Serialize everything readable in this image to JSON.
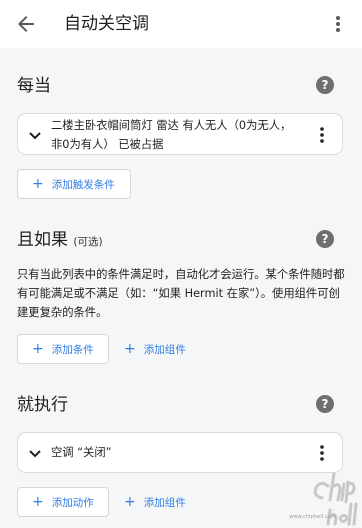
{
  "header": {
    "title": "自动关空调"
  },
  "trigger_section": {
    "title": "每当",
    "trigger_text": "二楼主卧衣帽间筒灯 雷达 有人无人（0为无人，非0为有人） 已被占据",
    "add_button": "添加触发条件"
  },
  "condition_section": {
    "title": "且如果",
    "optional_label": "(可选)",
    "description": "只有当此列表中的条件满足时，自动化才会运行。某个条件随时都有可能满足或不满足（如：“如果 Hermit 在家”）。使用组件可创建更复杂的条件。",
    "add_condition_button": "添加条件",
    "add_block_button": "添加组件"
  },
  "action_section": {
    "title": "就执行",
    "action_text": "空调 “关闭”",
    "add_action_button": "添加动作",
    "add_block_button": "添加组件"
  },
  "help_icon_glyph": "?",
  "watermark": {
    "logo_text": "chip hell",
    "url": "www.chiphell.com"
  },
  "colors": {
    "accent": "#2f7ee6",
    "background": "#f5f6f8",
    "help_icon": "#6f6f6f"
  }
}
